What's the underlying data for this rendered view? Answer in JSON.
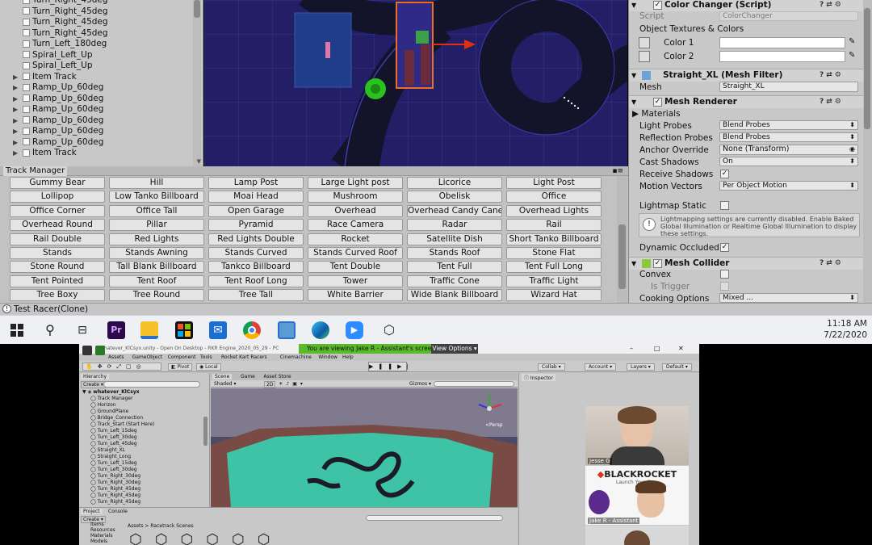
{
  "hierarchy": {
    "items": [
      "Turn_Right_45deg",
      "Turn_Right_45deg",
      "Turn_Right_45deg",
      "Turn_Right_45deg",
      "Turn_Left_180deg",
      "Spiral_Left_Up",
      "Spiral_Left_Up",
      "Item Track",
      "Ramp_Up_60deg",
      "Ramp_Up_60deg",
      "Ramp_Up_60deg",
      "Ramp_Up_60deg",
      "Ramp_Up_60deg",
      "Ramp_Up_60deg",
      "Item Track"
    ]
  },
  "track_manager": {
    "tab_label": "Track Manager",
    "buttons": [
      "Gummy Bear",
      "Hill",
      "Lamp Post",
      "Large Light post",
      "Licorice",
      "Light Post",
      "Lollipop",
      "Low Tanko Billboard",
      "Moai Head",
      "Mushroom",
      "Obelisk",
      "Office",
      "Office Corner",
      "Office Tall",
      "Open Garage",
      "Overhead",
      "Overhead Candy Cane",
      "Overhead Lights",
      "Overhead Round",
      "Pillar",
      "Pyramid",
      "Race Camera",
      "Radar",
      "Rail",
      "Rail Double",
      "Red Lights",
      "Red Lights Double",
      "Rocket",
      "Satellite Dish",
      "Short Tanko Billboard",
      "Stands",
      "Stands Awning",
      "Stands Curved",
      "Stands Curved Roof",
      "Stands Roof",
      "Stone Flat",
      "Stone Round",
      "Tall Blank Billboard",
      "Tankco Billboard",
      "Tent Double",
      "Tent Full",
      "Tent Full Long",
      "Tent Pointed",
      "Tent Roof",
      "Tent Roof Long",
      "Tower",
      "Traffic Cone",
      "Traffic Light",
      "Tree Boxy",
      "Tree Round",
      "Tree Tall",
      "White Barrier",
      "Wide Blank Billboard",
      "Wizard Hat"
    ]
  },
  "inspector": {
    "color_changer": {
      "title": "Color Changer (Script)",
      "script_label": "Script",
      "script_value": "ColorChanger",
      "section": "Object Textures & Colors",
      "color1": "Color 1",
      "color2": "Color 2"
    },
    "mesh_filter": {
      "title": "Straight_XL (Mesh Filter)",
      "mesh_label": "Mesh",
      "mesh_value": "Straight_XL"
    },
    "mesh_renderer": {
      "title": "Mesh Renderer",
      "materials": "Materials",
      "light_probes_label": "Light Probes",
      "light_probes": "Blend Probes",
      "reflection_probes_label": "Reflection Probes",
      "reflection_probes": "Blend Probes",
      "anchor_label": "Anchor Override",
      "anchor": "None (Transform)",
      "cast_label": "Cast Shadows",
      "cast": "On",
      "receive_label": "Receive Shadows",
      "motion_label": "Motion Vectors",
      "motion": "Per Object Motion",
      "lightmap_label": "Lightmap Static",
      "info": "Lightmapping settings are currently disabled. Enable Baked Global Illumination or Realtime Global Illumination to display these settings.",
      "occluded_label": "Dynamic Occluded"
    },
    "mesh_collider": {
      "title": "Mesh Collider",
      "convex": "Convex",
      "trigger": "Is Trigger",
      "cooking": "Cooking Options",
      "cooking_value": "Mixed ..."
    }
  },
  "status": {
    "text": "Test Racer(Clone)"
  },
  "taskbar": {
    "time": "11:18 AM",
    "date": "7/22/2020",
    "apps": [
      "windows-start",
      "search",
      "task-view",
      "premiere",
      "file-explorer",
      "store",
      "mail",
      "chrome",
      "photos",
      "edge",
      "zoom",
      "unity"
    ]
  },
  "share": {
    "window_title": "whatever_KlCsyx.unity - Open On Desktop - RKR Engine_2020_05_29 - PC",
    "viewing_banner": "You are viewing Jake R - Assistant's screen",
    "view_options": "View Options",
    "menu": [
      "Assets",
      "GameObject",
      "Component",
      "Tools",
      "Rocket Kart Racers",
      "Cinemachine",
      "Window",
      "Help"
    ],
    "toolbar": {
      "pivot": "Pivot",
      "local": "Local",
      "collab": "Collab",
      "account": "Account",
      "layers": "Layers",
      "default": "Default"
    },
    "hierarchy_title": "Hierarchy",
    "scene_root": "whatever_KlCsyx",
    "hierarchy_items": [
      "Track Manager",
      "Horizon",
      "GroundPlane",
      "Bridge_Connection",
      "Track_Start (Start Here)",
      "Turn_Left_15deg",
      "Turn_Left_30deg",
      "Turn_Left_45deg",
      "Straight_XL",
      "Straight_Long",
      "Turn_Left_15deg",
      "Turn_Left_30deg",
      "Turn_Right_30deg",
      "Turn_Right_30deg",
      "Turn_Right_45deg",
      "Turn_Right_45deg",
      "Turn_Right_45deg"
    ],
    "tabs": [
      "Scene",
      "Game",
      "Asset Store"
    ],
    "shaded": "Shaded",
    "twod": "2D",
    "gizmos": "Gizmos",
    "persp": "<Persp",
    "inspector_tab": "Inspector",
    "project_tab": "Project",
    "console_tab": "Console",
    "create": "Create",
    "project_tree": [
      "Items",
      "Resources",
      "Materials",
      "Models"
    ],
    "breadcrumb": "Assets > Racetrack Scenes"
  },
  "participants": [
    {
      "name": "Jesse G"
    },
    {
      "name": "Jake R - Assistant",
      "banner": "BLACKROCKET",
      "tagline": "Launch Your C..."
    },
    {
      "name": ""
    }
  ]
}
